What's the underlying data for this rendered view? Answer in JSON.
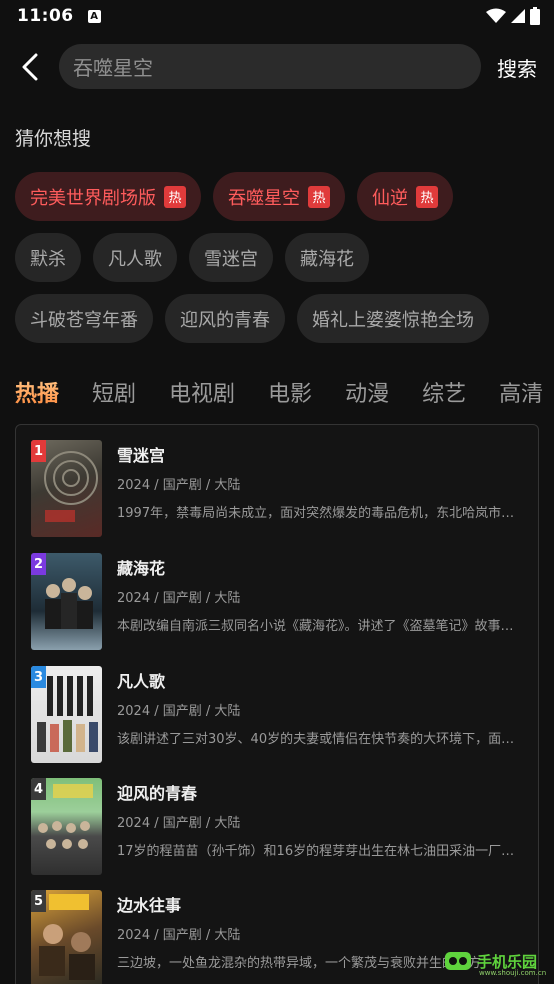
{
  "status_bar": {
    "time": "11:06",
    "notification_icon": "A"
  },
  "search": {
    "back_icon": "chevron-left-icon",
    "query": "吞噬星空",
    "button_label": "搜索"
  },
  "suggestions": {
    "title": "猜你想搜",
    "hot_badge": "热",
    "rows": [
      [
        {
          "label": "完美世界剧场版",
          "hot": true
        },
        {
          "label": "吞噬星空",
          "hot": true
        },
        {
          "label": "仙逆",
          "hot": true
        }
      ],
      [
        {
          "label": "默杀",
          "hot": false
        },
        {
          "label": "凡人歌",
          "hot": false
        },
        {
          "label": "雪迷宫",
          "hot": false
        },
        {
          "label": "藏海花",
          "hot": false
        }
      ],
      [
        {
          "label": "斗破苍穹年番",
          "hot": false
        },
        {
          "label": "迎风的青春",
          "hot": false
        },
        {
          "label": "婚礼上婆婆惊艳全场",
          "hot": false
        }
      ]
    ]
  },
  "tabs": [
    {
      "label": "热播",
      "active": true
    },
    {
      "label": "短剧",
      "active": false
    },
    {
      "label": "电视剧",
      "active": false
    },
    {
      "label": "电影",
      "active": false
    },
    {
      "label": "动漫",
      "active": false
    },
    {
      "label": "综艺",
      "active": false
    },
    {
      "label": "高清",
      "active": false
    }
  ],
  "ranking": [
    {
      "rank": "1",
      "title": "雪迷宫",
      "meta": "2024 / 国产剧 / 大陆",
      "desc": "1997年，禁毒局尚未成立，面对突然爆发的毒品危机，东北哈岚市公安局迅速行动",
      "rank_color": "#e23a3a"
    },
    {
      "rank": "2",
      "title": "藏海花",
      "meta": "2024 / 国产剧 / 大陆",
      "desc": "本剧改编自南派三叔同名小说《藏海花》。讲述了《盗墓笔记》故事结束之后",
      "rank_color": "#7b3ae0"
    },
    {
      "rank": "3",
      "title": "凡人歌",
      "meta": "2024 / 国产剧 / 大陆",
      "desc": "该剧讲述了三对30岁、40岁的夫妻或情侣在快节奏的大环境下，面对生活的困境",
      "rank_color": "#2a8ae0"
    },
    {
      "rank": "4",
      "title": "迎风的青春",
      "meta": "2024 / 国产剧 / 大陆",
      "desc": "17岁的程苗苗（孙千饰）和16岁的程芽芽出生在林七油田采油一厂的家庭",
      "rank_color": "#3a3a3a"
    },
    {
      "rank": "5",
      "title": "边水往事",
      "meta": "2024 / 国产剧 / 大陆",
      "desc": "三边坡，一处鱼龙混杂的热带异域，一个繁茂与衰败并生的地方",
      "rank_color": "#3a3a3a"
    }
  ],
  "watermark": {
    "text": "手机乐园",
    "sub": "www.shouji.com.cn"
  }
}
